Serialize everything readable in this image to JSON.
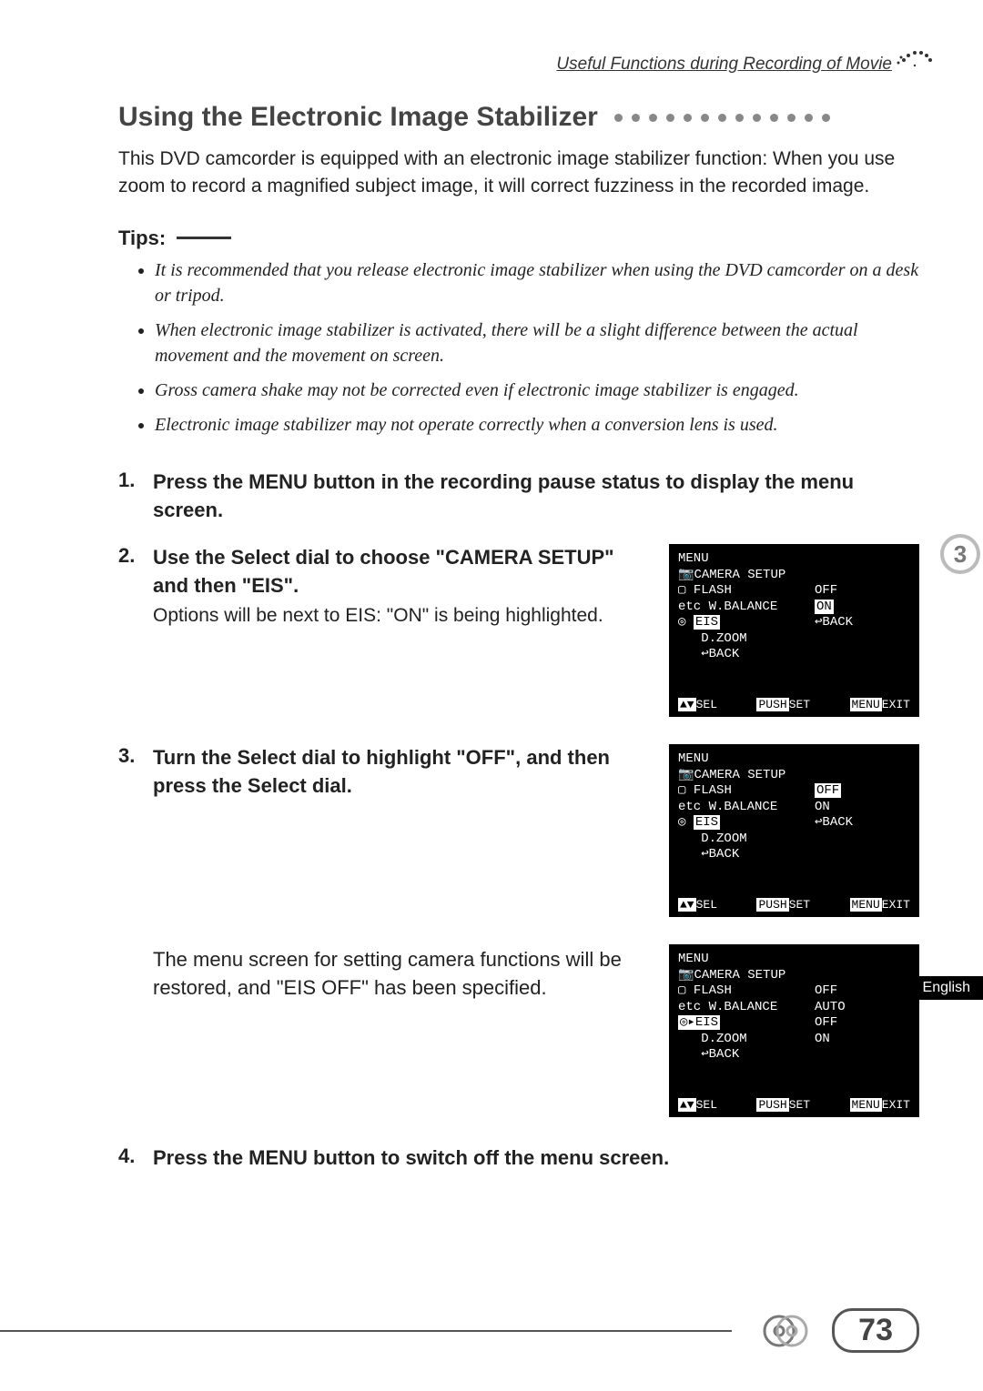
{
  "header": {
    "section": "Useful Functions during Recording of Movie"
  },
  "title": "Using the Electronic Image Stabilizer",
  "intro": "This DVD camcorder is equipped with an electronic image stabilizer function: When you use zoom to record a magnified subject image, it will correct fuzziness in the recorded image.",
  "tips": {
    "title": "Tips:",
    "items": [
      "It is recommended that you release electronic image stabilizer when using the DVD camcorder on a desk or tripod.",
      "When electronic image stabilizer is activated, there will be a slight difference between the actual movement and the movement on screen.",
      "Gross camera shake may not be corrected even if electronic image stabilizer is engaged.",
      "Electronic image stabilizer may not operate correctly when a conversion lens is used."
    ]
  },
  "steps": {
    "s1": {
      "num": "1.",
      "bold": "Press the MENU button in the recording pause status to display the menu screen."
    },
    "s2": {
      "num": "2.",
      "bold": "Use the Select dial to choose \"CAMERA SETUP\" and then \"EIS\".",
      "sub": "Options will be next to EIS: \"ON\" is being highlighted."
    },
    "s3": {
      "num": "3.",
      "bold": "Turn the Select dial to highlight \"OFF\", and then press the Select dial.",
      "sub": "The menu screen for setting camera functions will be restored, and \"EIS OFF\" has been specified."
    },
    "s4": {
      "num": "4.",
      "bold": "Press the MENU button to switch off the menu screen."
    }
  },
  "menus": {
    "common": {
      "title": "MENU",
      "heading": "CAMERA SETUP",
      "items": [
        "FLASH",
        "W.BALANCE",
        "EIS",
        "D.ZOOM",
        "↩BACK"
      ],
      "footer": {
        "sel": "▲▼",
        "sel_label": "SEL",
        "push": "PUSH",
        "push_label": "SET",
        "menu": "MENU",
        "menu_label": "EXIT"
      }
    },
    "m1": {
      "right": [
        "OFF",
        "ON",
        "↩BACK"
      ],
      "highlight_right_index": 1,
      "highlight_left_index": 2
    },
    "m2": {
      "right": [
        "OFF",
        "ON",
        "↩BACK"
      ],
      "highlight_right_index": 0,
      "highlight_left_index": 2
    },
    "m3": {
      "right_values": [
        "OFF",
        "AUTO",
        "OFF",
        "ON"
      ],
      "highlight_left_index": 2,
      "arrow_on_index": 2
    }
  },
  "side_badge": {
    "number": "3"
  },
  "lang_tab": "English",
  "page_number": "73"
}
